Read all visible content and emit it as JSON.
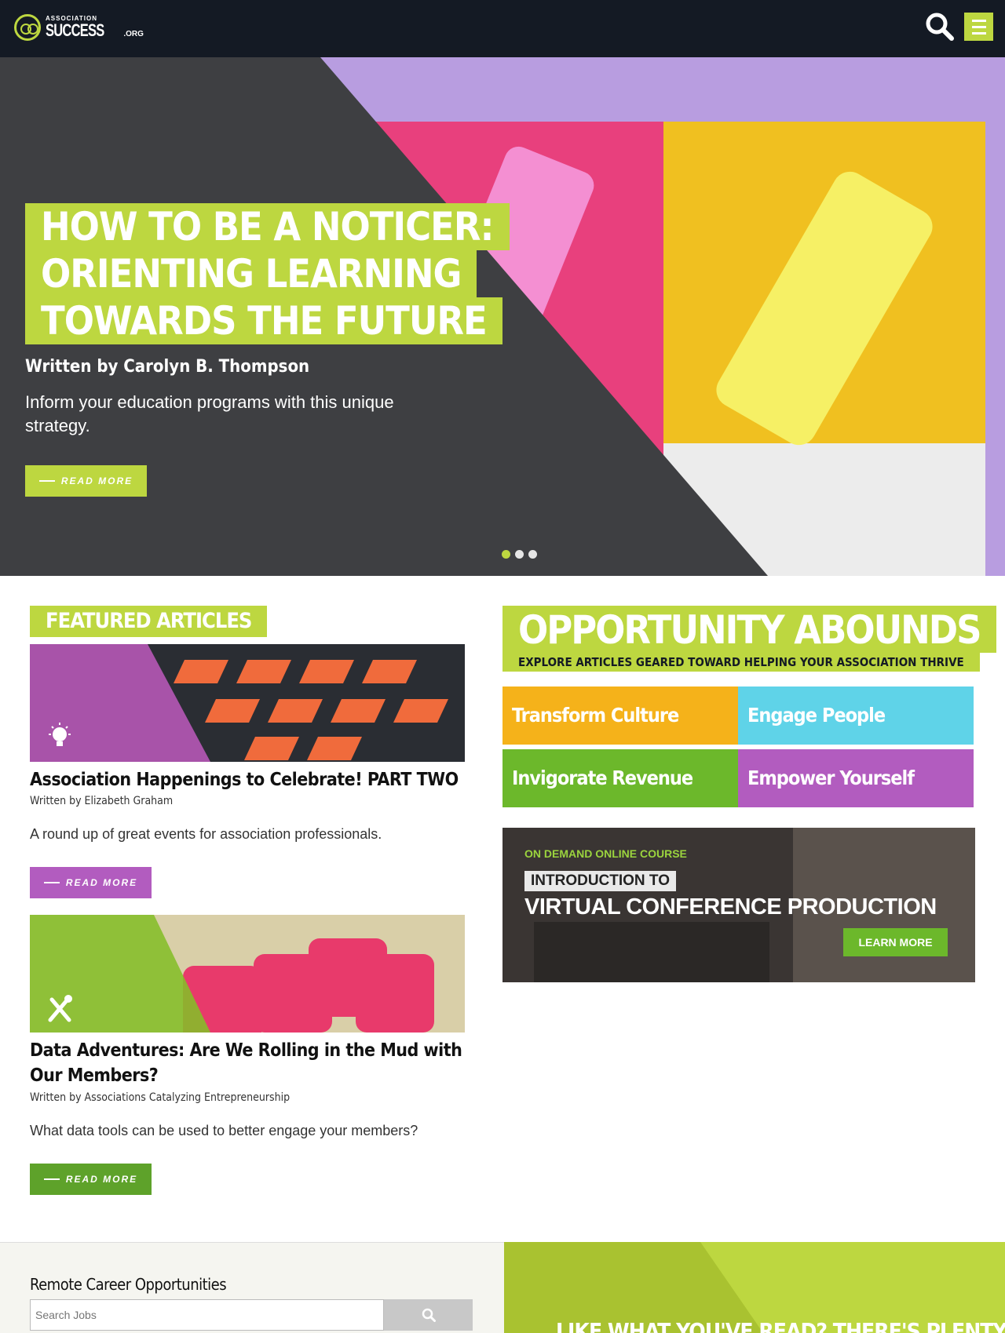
{
  "header": {
    "logo_small": "ASSOCIATION",
    "logo_big": "SUCCESS",
    "logo_org": ".ORG"
  },
  "hero": {
    "title_lines": [
      "HOW TO BE A NOTICER:",
      "ORIENTING LEARNING",
      "TOWARDS THE FUTURE"
    ],
    "author": "Written by Carolyn B. Thompson",
    "description": "Inform your education programs with this unique strategy.",
    "read_more": "READ MORE",
    "slide_count": 3,
    "active_slide": 1
  },
  "featured": {
    "heading": "FEATURED ARTICLES",
    "articles": [
      {
        "title": "Association Happenings to Celebrate! PART TWO",
        "author": "Written by Elizabeth Graham",
        "description": "A round up of great events for association professionals.",
        "read_more": "READ MORE",
        "icon": "lightbulb-icon",
        "accent": "#b25cbf"
      },
      {
        "title": "Data Adventures: Are We Rolling in the Mud with Our Members?",
        "author": "Written by Associations Catalyzing Entrepreneurship",
        "description": "What data tools can be used to better engage your members?",
        "read_more": "READ MORE",
        "icon": "tools-icon",
        "accent": "#5ea22a"
      }
    ]
  },
  "opportunity": {
    "title": "OPPORTUNITY ABOUNDS",
    "subtitle": "EXPLORE ARTICLES GEARED TOWARD HELPING YOUR ASSOCIATION THRIVE",
    "tiles": [
      "Transform Culture",
      "Engage People",
      "Invigorate Revenue",
      "Empower Yourself"
    ]
  },
  "ad": {
    "kicker": "ON DEMAND ONLINE COURSE",
    "intro": "INTRODUCTION TO",
    "title": "VIRTUAL CONFERENCE PRODUCTION",
    "button": "LEARN MORE"
  },
  "careers": {
    "title": "Remote Career Opportunities",
    "search_placeholder": "Search Jobs"
  },
  "promo": {
    "text": "LIKE WHAT YOU'VE READ? THERE'S PLENTY"
  },
  "colors": {
    "brand_green": "#bdd740",
    "header_bg": "#141a24",
    "purple": "#b25cbf",
    "dark_green": "#5ea22a"
  }
}
